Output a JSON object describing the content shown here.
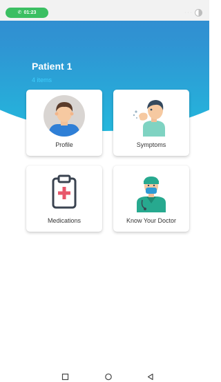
{
  "status_bar": {
    "call_time": "01:23",
    "icons": [
      "phone-icon",
      "moon-icon"
    ]
  },
  "header": {
    "title": "Patient 1",
    "subtitle": "4 items"
  },
  "cards": {
    "profile": {
      "label": "Profile",
      "icon": "avatar-icon"
    },
    "symptoms": {
      "label": "Symptoms",
      "icon": "coughing-person-icon"
    },
    "medications": {
      "label": "Medications",
      "icon": "clipboard-medical-icon"
    },
    "doctor": {
      "label": "Know Your Doctor",
      "icon": "doctor-icon"
    }
  },
  "nav": {
    "icons": [
      "recent-apps-icon",
      "home-icon",
      "back-icon"
    ]
  },
  "colors": {
    "call_pill": "#3bbf62",
    "header_top": "#3e70c6",
    "header_bottom": "#24b7dc",
    "subtitle": "#3fd0ff",
    "card_text": "#333333"
  }
}
